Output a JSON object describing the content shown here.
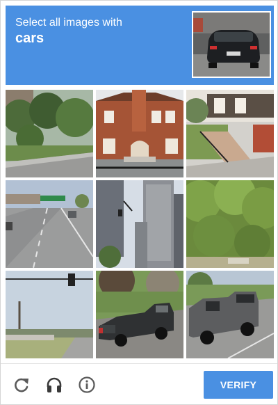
{
  "challenge": {
    "instruction": "Select all images with",
    "target": "cars"
  },
  "footer": {
    "reload_icon": "reload-icon",
    "audio_icon": "headphones-icon",
    "info_icon": "info-icon",
    "verify_label": "VERIFY"
  },
  "colors": {
    "accent": "#4a90e2"
  }
}
